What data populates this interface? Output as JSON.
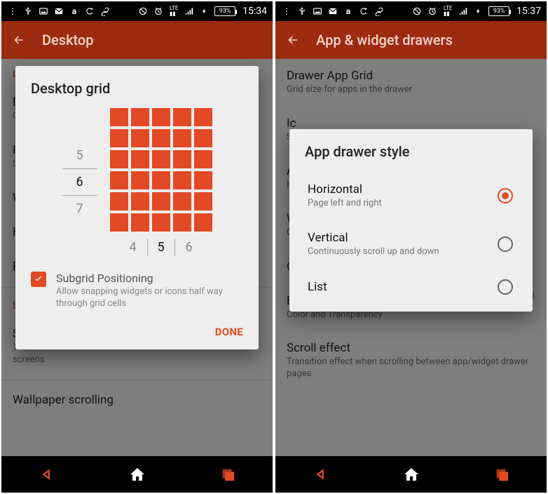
{
  "left": {
    "status": {
      "battery": "93%",
      "time": "15:34"
    },
    "appbar_title": "Desktop",
    "settings_preview": {
      "section1": "L",
      "i1_label": "D",
      "i1_sub": "G",
      "i2_label": "Ic",
      "i2_sub": "S",
      "i3_label": "W",
      "i4_label": "H",
      "i5_label": "P",
      "section2": "S",
      "i6_label": "S",
      "i6_sub": "T\nscreens",
      "i7_label": "Wallpaper scrolling"
    },
    "dialog": {
      "title": "Desktop grid",
      "rows": [
        "5",
        "6",
        "7"
      ],
      "row_selected": 1,
      "cols": [
        "4",
        "5",
        "6"
      ],
      "col_selected": 1,
      "subgrid_title": "Subgrid Positioning",
      "subgrid_sub": "Allow snapping widgets or icons half way through grid cells",
      "subgrid_checked": true,
      "done": "DONE"
    }
  },
  "right": {
    "status": {
      "battery": "93%",
      "time": "15:37"
    },
    "appbar_title": "App & widget drawers",
    "settings_preview": {
      "i1_label": "Drawer App Grid",
      "i1_sub": "Grid size for apps in the drawer",
      "i2_label": "Ic",
      "i2_sub": "S",
      "i3_label": "A",
      "i3_sub": "H",
      "i4_label": "W",
      "i4_sub": "G",
      "i5_label": "C",
      "i6_label": "Background",
      "i6_sub": "Color and Transparency",
      "i7_label": "Scroll effect",
      "i7_sub": "Transition effect when scrolling between app/widget drawer pages"
    },
    "dialog": {
      "title": "App drawer style",
      "options": [
        {
          "label": "Horizontal",
          "sub": "Page left and right",
          "selected": true
        },
        {
          "label": "Vertical",
          "sub": "Continuously scroll up and down",
          "selected": false
        },
        {
          "label": "List",
          "sub": "",
          "selected": false
        }
      ]
    }
  }
}
